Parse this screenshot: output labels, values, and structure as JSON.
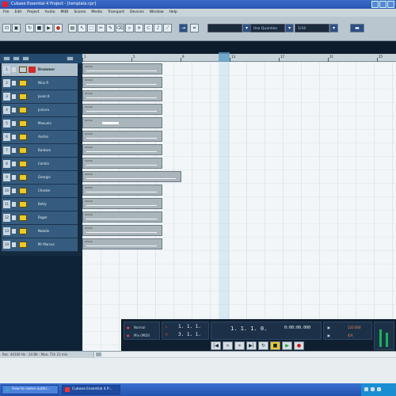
{
  "window": {
    "title": "Cubase Essential 4 Project - [template.cpr]"
  },
  "menu": [
    "File",
    "Edit",
    "Project",
    "Audio",
    "MIDI",
    "Scores",
    "Media",
    "Transport",
    "Devices",
    "Window",
    "Help"
  ],
  "toolbar": {
    "quantize_display": "Use Quantize",
    "grid_display": "1/16"
  },
  "ruler": {
    "marks": [
      "1",
      "5",
      "9",
      "13",
      "17",
      "21",
      "25"
    ]
  },
  "tracks": [
    {
      "num": "1",
      "name": "Drummer"
    },
    {
      "num": "2",
      "name": "Nino R"
    },
    {
      "num": "3",
      "name": "Jason K"
    },
    {
      "num": "4",
      "name": "Juniora"
    },
    {
      "num": "5",
      "name": "Maxuela"
    },
    {
      "num": "6",
      "name": "Andrei"
    },
    {
      "num": "7",
      "name": "Barbara"
    },
    {
      "num": "8",
      "name": "Camila"
    },
    {
      "num": "9",
      "name": "Georgie"
    },
    {
      "num": "10",
      "name": "Chester"
    },
    {
      "num": "11",
      "name": "Betty"
    },
    {
      "num": "12",
      "name": "Roger"
    },
    {
      "num": "13",
      "name": "Natalie"
    },
    {
      "num": "14",
      "name": "Mr Marcus"
    }
  ],
  "transport": {
    "punch_in": "Normal",
    "punch_out": "Mix (MIDI)",
    "left_locator": "1. 1. 1.",
    "right_locator": "3. 1. 1.",
    "position_bars": "1. 1. 1. 0.",
    "position_time": "0:00:00.000",
    "tempo": "120.000",
    "signature": "4/4"
  },
  "status": {
    "text": "Rec: 44100 Hz - 24 Bit - Max: 71h 21 min"
  },
  "taskbar": {
    "tasks": [
      "How to name outlin...",
      "Cubase Essential 4 P..."
    ]
  }
}
